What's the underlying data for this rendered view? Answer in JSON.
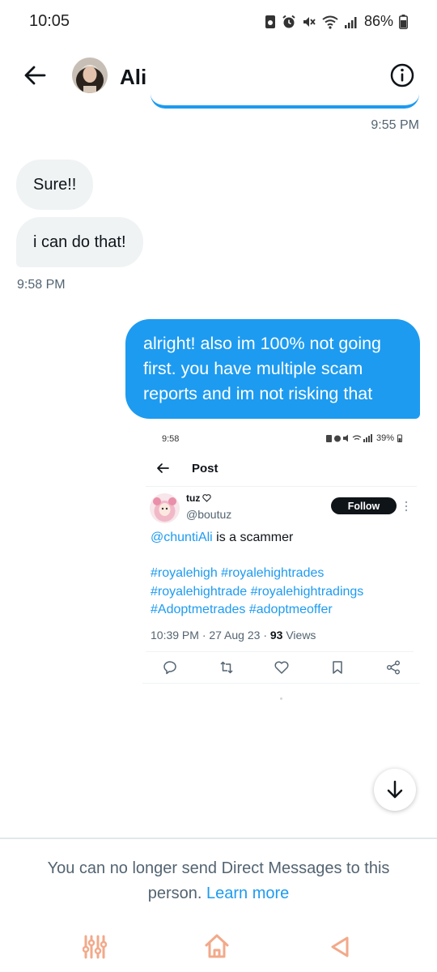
{
  "status_bar": {
    "time": "10:05",
    "battery": "86%",
    "icons": [
      "screenshot-icon",
      "alarm-icon",
      "mute-icon",
      "wifi-icon",
      "signal-icon",
      "battery-charging-icon"
    ]
  },
  "header": {
    "contact_name": "Ali",
    "back_icon": "arrow-left-icon",
    "info_icon": "info-circle-icon"
  },
  "messages": {
    "timestamp_prev": "9:55 PM",
    "incoming": [
      {
        "text": "Sure!!"
      },
      {
        "text": "i can do that!"
      }
    ],
    "timestamp_incoming": "9:58 PM",
    "outgoing": {
      "lines": [
        "alright! also im 100% not going",
        "first. you have multiple scam",
        "reports and im not risking that"
      ]
    }
  },
  "embedded_screenshot": {
    "status_time": "9:58",
    "status_battery": "39%",
    "title": "Post",
    "author_name": "tuz",
    "author_handle": "@boutuz",
    "follow_label": "Follow",
    "mention": "@chuntiAli",
    "body_rest": " is a scammer",
    "hashtag_lines": [
      "#royalehigh #royalehightrades",
      "#royalehightrade #royalehightradings",
      "#Adoptmetrades #adoptmeoffer"
    ],
    "meta_time": "10:39 PM · 27 Aug 23 · ",
    "views_count": "93",
    "views_label": " Views",
    "actions": [
      "reply-icon",
      "retweet-icon",
      "like-icon",
      "bookmark-icon",
      "share-icon"
    ]
  },
  "footer": {
    "notice_text": "You can no longer send Direct Messages to this person.",
    "learn_more": "Learn more"
  },
  "colors": {
    "accent": "#1d9bf0",
    "incoming_bubble": "#eff3f4",
    "secondary_text": "#536471",
    "nav_icons": "#f2a98a"
  }
}
